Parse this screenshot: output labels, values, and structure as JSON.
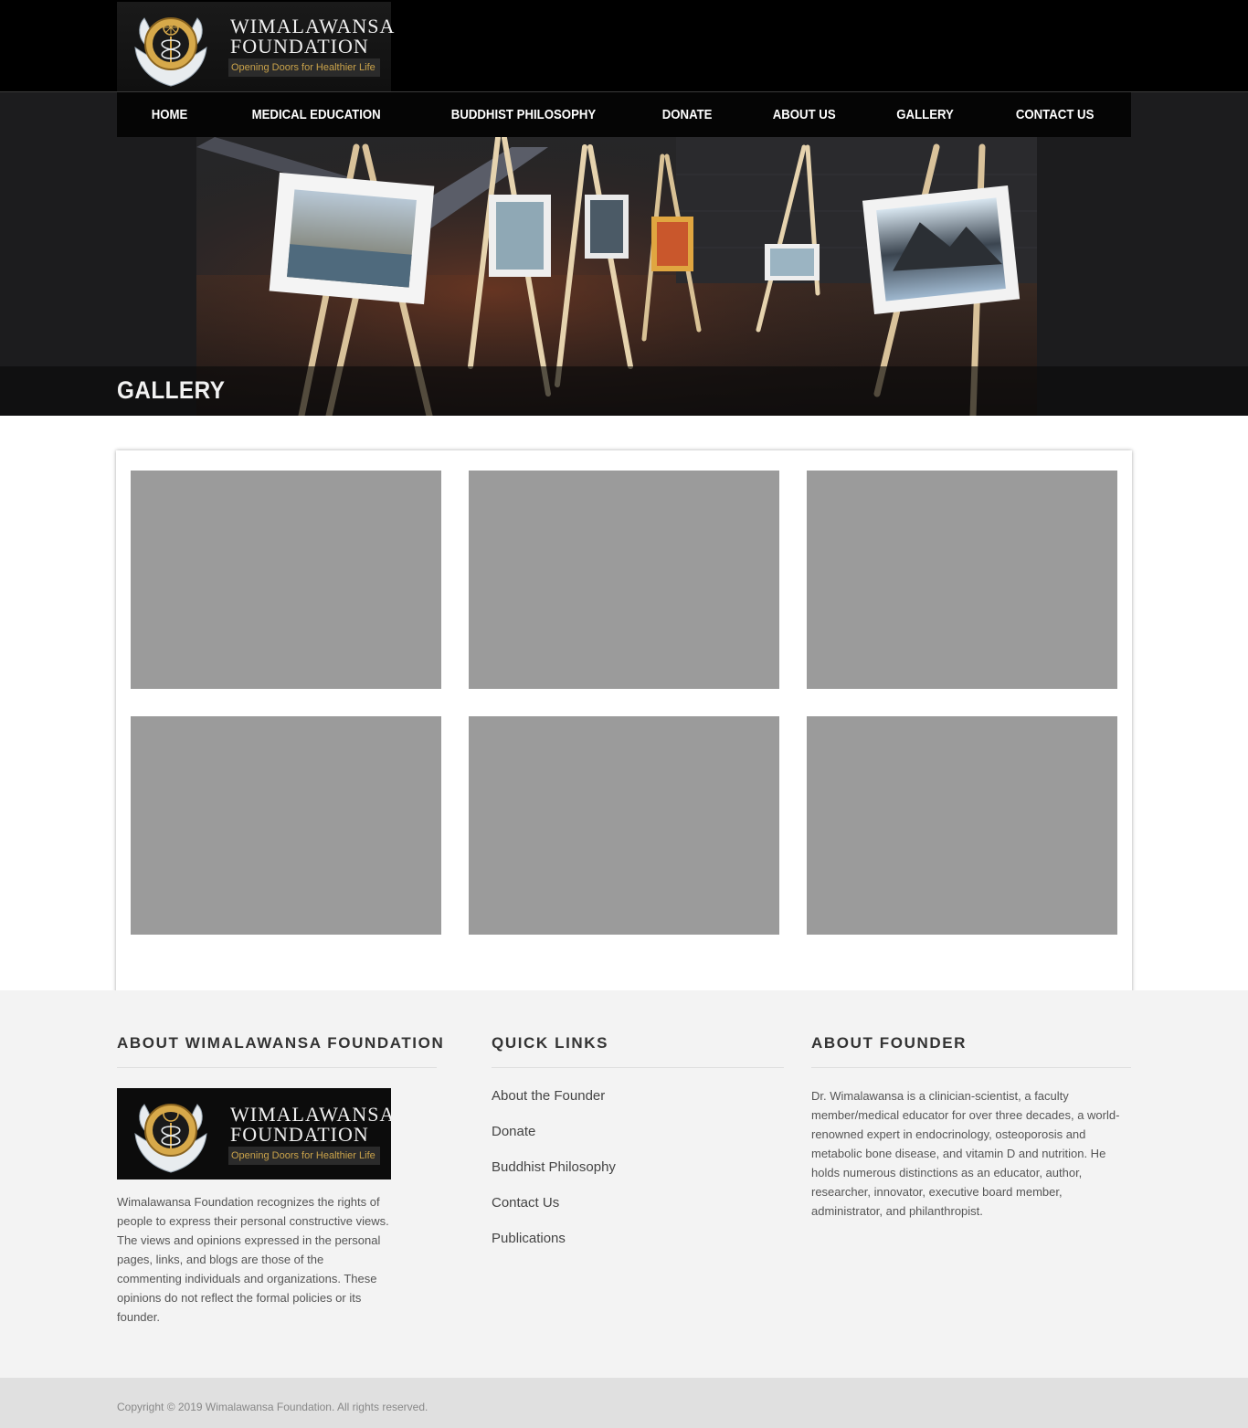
{
  "brand": {
    "name_line1": "WIMALAWANSA",
    "name_line2": "FOUNDATION",
    "tagline": "Opening Doors for Healthier Life",
    "accent_gold": "#c9a24a"
  },
  "nav": {
    "items": [
      {
        "label": "HOME"
      },
      {
        "label": "MEDICAL EDUCATION"
      },
      {
        "label": "BUDDHIST PHILOSOPHY"
      },
      {
        "label": "DONATE"
      },
      {
        "label": "ABOUT US"
      },
      {
        "label": "GALLERY"
      },
      {
        "label": "CONTACT US"
      }
    ]
  },
  "hero": {
    "title": "GALLERY",
    "image": "art-gallery-easels-image"
  },
  "gallery": {
    "placeholder_color": "#9b9b9b",
    "thumbnails": [
      "gallery-image-1",
      "gallery-image-2",
      "gallery-image-3",
      "gallery-image-4",
      "gallery-image-5",
      "gallery-image-6"
    ]
  },
  "footer": {
    "about": {
      "heading": "ABOUT WIMALAWANSA FOUNDATION",
      "text": "Wimalawansa Foundation recognizes the rights of people to express their personal constructive views. The views and opinions expressed in the personal pages, links, and blogs are those of the commenting individuals and organizations. These opinions do not reflect the formal policies or its founder."
    },
    "quick_links": {
      "heading": "QUICK LINKS",
      "items": [
        {
          "label": "About the Founder"
        },
        {
          "label": "Donate"
        },
        {
          "label": "Buddhist Philosophy"
        },
        {
          "label": "Contact Us"
        },
        {
          "label": "Publications"
        }
      ]
    },
    "founder": {
      "heading": "ABOUT FOUNDER",
      "text": "Dr. Wimalawansa is a clinician-scientist, a faculty member/medical educator for over three decades, a world-renowned expert in endocrinology, osteoporosis and metabolic bone disease, and vitamin D and nutrition. He holds numerous distinctions as an educator, author, researcher, innovator, executive board member, administrator, and philanthropist."
    },
    "copyright": "Copyright © 2019 Wimalawansa Foundation. All rights reserved."
  }
}
